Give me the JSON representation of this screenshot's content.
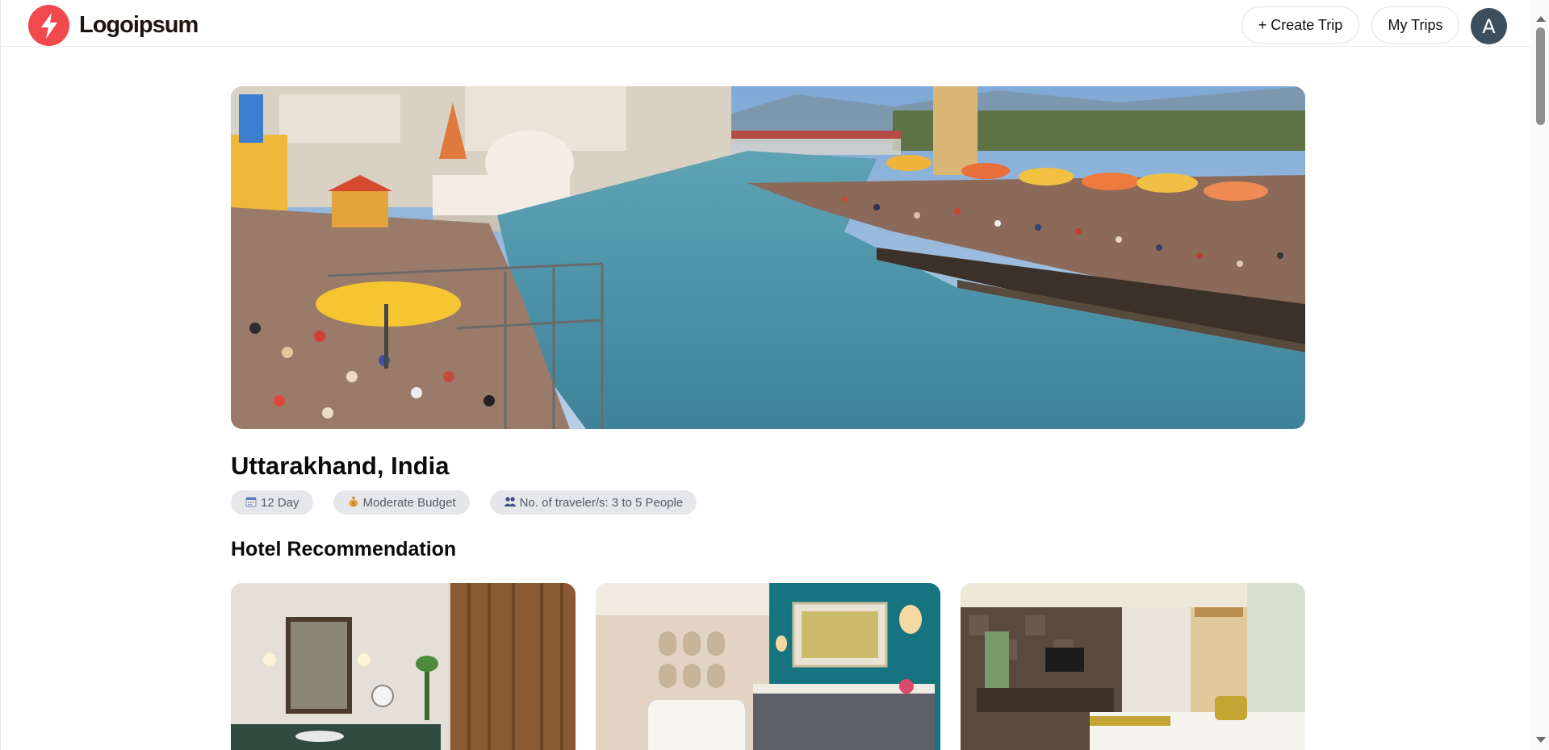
{
  "header": {
    "logo_text": "Logoipsum",
    "create_trip_label": "+ Create Trip",
    "my_trips_label": "My Trips",
    "avatar_initial": "A"
  },
  "trip": {
    "place": "Uttarakhand, India",
    "chips": [
      {
        "icon": "calendar-icon",
        "label": "12 Day"
      },
      {
        "icon": "money-bag-icon",
        "label": "Moderate Budget"
      },
      {
        "icon": "people-icon",
        "label": "No. of traveler/s: 3 to 5 People"
      }
    ]
  },
  "sections": {
    "hotels_title": "Hotel Recommendation"
  },
  "colors": {
    "brand": "#f04a4f",
    "chip_bg": "#e5e7eb",
    "avatar_bg": "#3d4f5c"
  }
}
